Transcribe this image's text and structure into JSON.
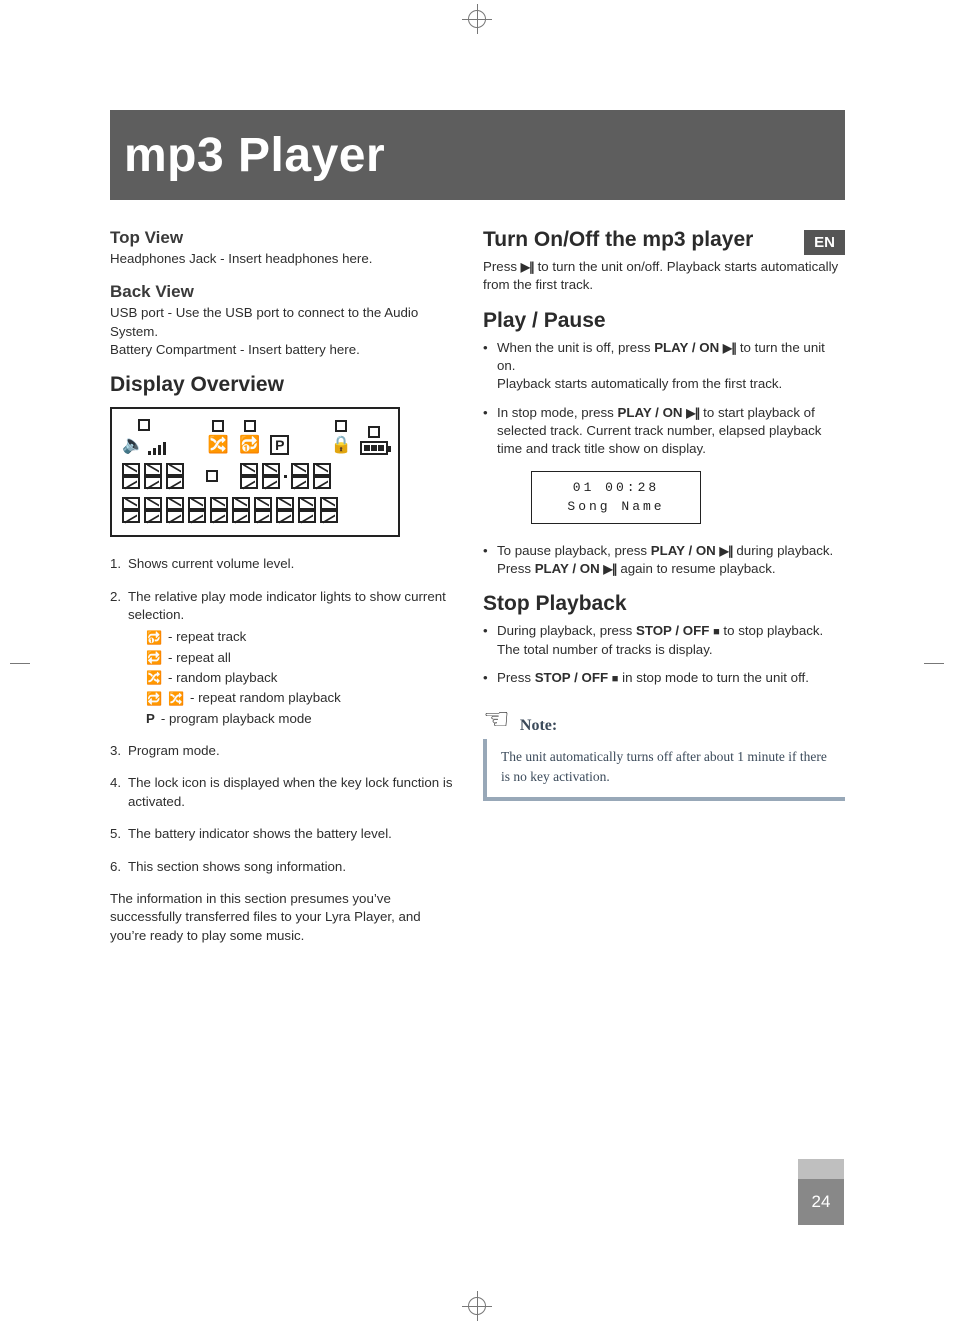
{
  "lang_badge": "EN",
  "title": "mp3 Player",
  "page_number": "24",
  "left": {
    "top_view": {
      "heading": "Top View",
      "text": "Headphones Jack - Insert headphones here."
    },
    "back_view": {
      "heading": "Back View",
      "line1": "USB port - Use the USB port to connect to the Audio System.",
      "line2": "Battery Compartment - Insert battery here."
    },
    "display_overview": {
      "heading": "Display Overview",
      "items": [
        "Shows current volume level.",
        "The relative play mode indicator lights to show current selection.",
        "Program mode.",
        "The lock icon is displayed when the key lock function is activated.",
        "The battery indicator shows the battery level.",
        "This section shows song information."
      ],
      "modes": {
        "repeat_track": "- repeat track",
        "repeat_all": "- repeat all",
        "random": "- random playback",
        "repeat_random": "- repeat random playback",
        "program_label": "P",
        "program_text": " - program playback mode"
      },
      "footer": "The information in this section presumes you’ve successfully transferred files to your Lyra Player, and you’re ready to play some music."
    }
  },
  "right": {
    "turn": {
      "heading": "Turn On/Off the mp3 player",
      "text_pre": "Press  ",
      "text_post": "  to turn the unit on/off. Playback starts automatically from the first track."
    },
    "play_pause": {
      "heading": "Play / Pause",
      "b1_pre": "When the unit is off, press ",
      "b1_bold": "PLAY / ON",
      "b1_post": " to turn the unit on.",
      "b1_line2": "Playback starts automatically from the first track.",
      "b2_pre": "In stop mode, press ",
      "b2_bold": "PLAY / ON",
      "b2_post": " to start playback of selected track. Current track number, elapsed playback time and track title show on display.",
      "b3_pre": "To pause playback, press ",
      "b3_bold": "PLAY / ON",
      "b3_post": " during playback.",
      "b3_line2_pre": "Press ",
      "b3_line2_bold": "PLAY / ON",
      "b3_line2_post": " again to resume playback."
    },
    "lcd": {
      "line1": "01   00:28",
      "line2": "Song Name"
    },
    "stop": {
      "heading": "Stop Playback",
      "b1_pre": "During playback, press ",
      "b1_bold": "STOP / OFF",
      "b1_post": " to stop playback.  The total number of tracks is display.",
      "b2_pre": "Press ",
      "b2_bold": "STOP / OFF",
      "b2_post": " in stop mode to turn the unit off."
    },
    "note": {
      "label": "Note:",
      "body": "The unit automatically turns off after about 1 minute if there is no key activation."
    }
  }
}
